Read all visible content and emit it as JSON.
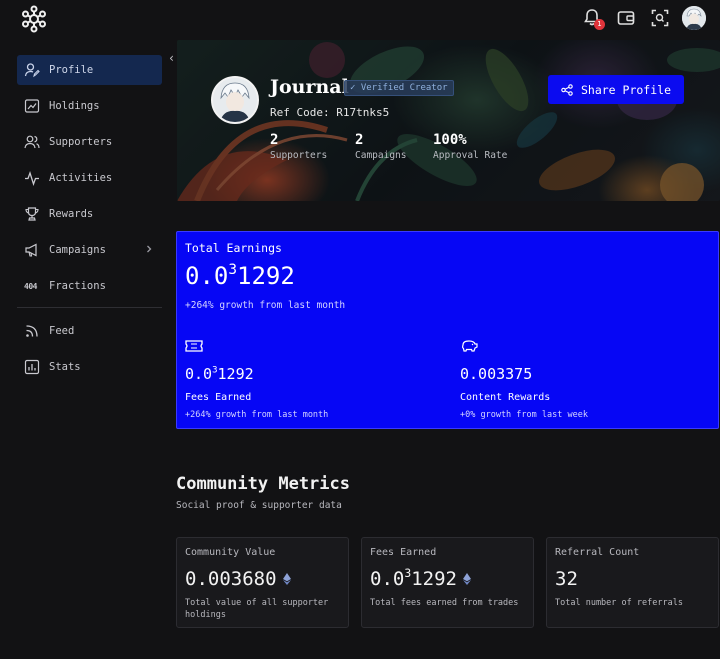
{
  "topbar": {
    "logo_icon": "hexagon-network-logo",
    "notification_count": "1",
    "icons": [
      "bell-icon",
      "wallet-icon",
      "scan-icon",
      "avatar"
    ]
  },
  "sidebar": {
    "items": [
      {
        "label": "Profile",
        "icon": "user-icon",
        "active": true
      },
      {
        "label": "Holdings",
        "icon": "chart-icon"
      },
      {
        "label": "Supporters",
        "icon": "users-icon"
      },
      {
        "label": "Activities",
        "icon": "activity-icon"
      },
      {
        "label": "Rewards",
        "icon": "trophy-icon"
      },
      {
        "label": "Campaigns",
        "icon": "megaphone-icon"
      },
      {
        "label": "Fractions",
        "icon_text": "404"
      },
      {
        "label": "Feed",
        "icon": "rss-icon"
      },
      {
        "label": "Stats",
        "icon": "stats-icon"
      }
    ],
    "collapse_glyph": "‹"
  },
  "profile": {
    "name": "Journal",
    "verified_label": "✓ Verified Creator",
    "ref_code": "Ref Code: R17tnks5",
    "stats": [
      {
        "value": "2",
        "label": "Supporters"
      },
      {
        "value": "2",
        "label": "Campaigns"
      },
      {
        "value": "100%",
        "label": "Approval Rate"
      }
    ],
    "share_label": "Share Profile"
  },
  "earnings": {
    "title": "Total Earnings",
    "total_prefix": "0.0",
    "total_sup": "3",
    "total_rest": "1292",
    "growth": "+264% growth from last month",
    "fees": {
      "value_prefix": "0.0",
      "value_sup": "3",
      "value_rest": "1292",
      "label": "Fees Earned",
      "growth": "+264% growth from last month"
    },
    "content": {
      "value": "0.003375",
      "label": "Content Rewards",
      "growth": "+0% growth from last week"
    },
    "accent": "#0606f5"
  },
  "community": {
    "title": "Community Metrics",
    "subtitle": "Social proof & supporter data",
    "cards": [
      {
        "title": "Community Value",
        "value": "0.003680",
        "desc": "Total value of all supporter holdings"
      },
      {
        "title": "Fees Earned",
        "value_prefix": "0.0",
        "value_sup": "3",
        "value_rest": "1292",
        "desc": "Total fees earned from trades"
      },
      {
        "title": "Referral Count",
        "value": "32",
        "desc": "Total number of referrals"
      }
    ]
  }
}
